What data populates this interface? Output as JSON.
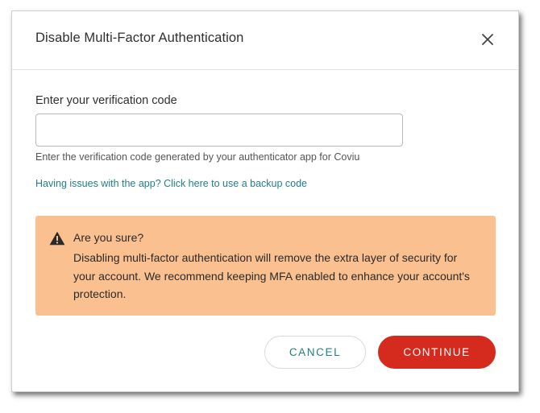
{
  "dialog": {
    "title": "Disable Multi-Factor Authentication",
    "close_icon": "close-icon"
  },
  "verification": {
    "label": "Enter your verification code",
    "value": "",
    "placeholder": "",
    "help_text": "Enter the verification code generated by your authenticator app for Coviu",
    "backup_link": "Having issues with the app? Click here to use a backup code"
  },
  "warning": {
    "icon": "warning-icon",
    "title": "Are you sure?",
    "body": "Disabling multi-factor authentication will remove the extra layer of security for your account. We recommend keeping MFA enabled to enhance your account's protection."
  },
  "actions": {
    "cancel_label": "CANCEL",
    "continue_label": "CONTINUE"
  },
  "colors": {
    "accent_teal": "#1f7f87",
    "danger_red": "#d52a1e",
    "warning_bg": "#fbc08f"
  }
}
